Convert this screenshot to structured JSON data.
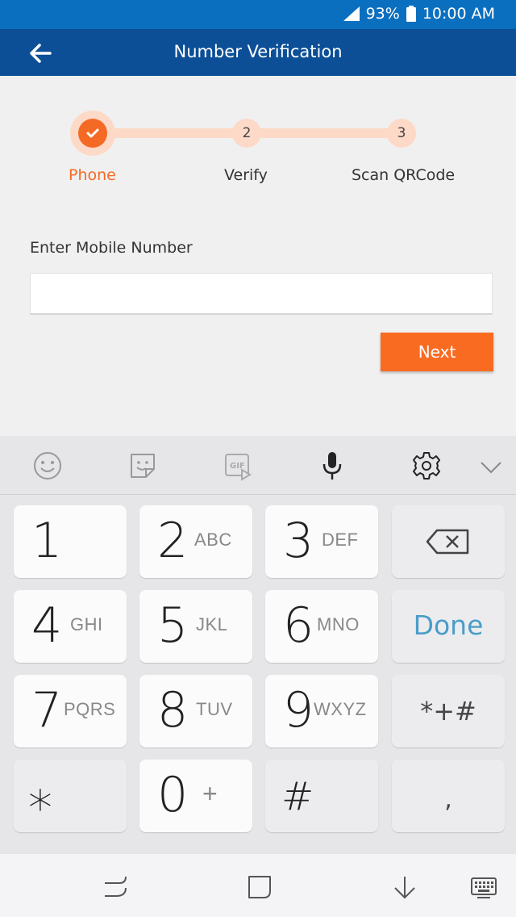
{
  "status_bar": {
    "battery": "93%",
    "time": "10:00 AM"
  },
  "app_bar": {
    "title": "Number Verification",
    "back_icon": "arrow-left-icon"
  },
  "stepper": {
    "steps": [
      {
        "number": "✓",
        "label": "Phone",
        "state": "complete"
      },
      {
        "number": "2",
        "label": "Verify",
        "state": "pending"
      },
      {
        "number": "3",
        "label": "Scan QRCode",
        "state": "pending"
      }
    ],
    "accent_color": "#f46a25",
    "inactive_color": "#fdd9c7"
  },
  "form": {
    "label": "Enter Mobile Number",
    "mobile_value": "",
    "next_label": "Next"
  },
  "keyboard_toolbar": [
    "emoji-icon",
    "sticker-icon",
    "gif-icon",
    "microphone-icon",
    "settings-icon",
    "chevron-down-icon"
  ],
  "keypad": {
    "k1": {
      "num": "1",
      "letters": ""
    },
    "k2": {
      "num": "2",
      "letters": "ABC"
    },
    "k3": {
      "num": "3",
      "letters": "DEF"
    },
    "k4": {
      "num": "4",
      "letters": "GHI"
    },
    "k5": {
      "num": "5",
      "letters": "JKL"
    },
    "k6": {
      "num": "6",
      "letters": "MNO"
    },
    "k7": {
      "num": "7",
      "letters": "PQRS"
    },
    "k8": {
      "num": "8",
      "letters": "TUV"
    },
    "k9": {
      "num": "9",
      "letters": "WXYZ"
    },
    "k0": {
      "num": "0",
      "letters": "+"
    },
    "star": "⁎",
    "hash": "#",
    "done": "Done",
    "symbols": "*+#",
    "comma": ","
  },
  "navbar": [
    "recent-apps-icon",
    "home-icon",
    "hide-keyboard-icon",
    "keyboard-switch-icon"
  ]
}
